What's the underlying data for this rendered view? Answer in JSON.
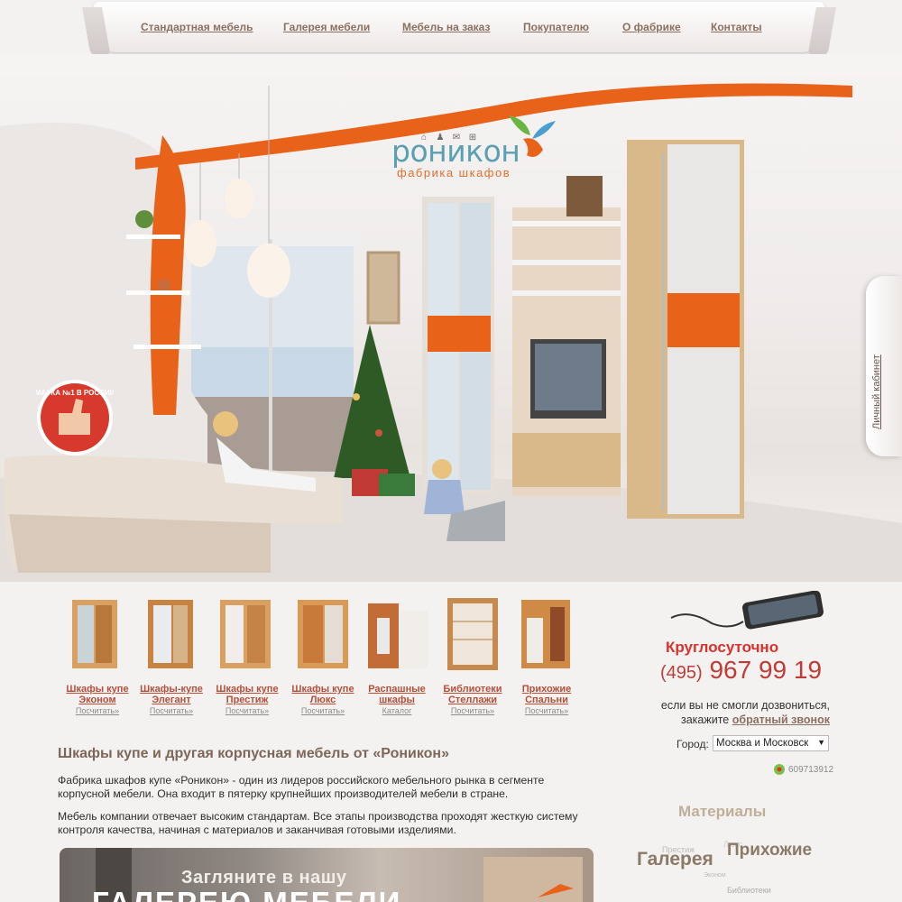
{
  "nav": {
    "items": [
      {
        "label": "Стандартная мебель"
      },
      {
        "label": "Галерея мебели"
      },
      {
        "label": "Мебель на заказ"
      },
      {
        "label": "Покупателю"
      },
      {
        "label": "О фабрике"
      },
      {
        "label": "Контакты"
      }
    ]
  },
  "logo": {
    "icons": [
      "home-icon",
      "users-icon",
      "mail-icon",
      "sitemap-icon"
    ],
    "name": "роникон",
    "tagline": "фабрика шкафов"
  },
  "side_tab": {
    "label": "Личный кабинет"
  },
  "badge": {
    "text": "МАРКА №1 В РОССИИ"
  },
  "products": [
    {
      "name1": "Шкафы купе",
      "name2": "Эконом",
      "sub": "Посчитать»"
    },
    {
      "name1": "Шкафы-купе",
      "name2": "Элегант",
      "sub": "Посчитать»"
    },
    {
      "name1": "Шкафы купе",
      "name2": "Престиж",
      "sub": "Посчитать»"
    },
    {
      "name1": "Шкафы купе",
      "name2": "Люкс",
      "sub": "Посчитать»"
    },
    {
      "name1": "Распашные",
      "name2": "шкафы",
      "sub": "Каталог"
    },
    {
      "name1": "Библиотеки",
      "name2": "Стеллажи",
      "sub": "Посчитать»"
    },
    {
      "name1": "Прихожие",
      "name2": "Спальни",
      "sub": "Посчитать»"
    }
  ],
  "contact": {
    "around_clock": "Круглосуточно",
    "phone_code": "(495)",
    "phone_number": "967 99 19",
    "note_line1": "если вы не смогли дозвониться,",
    "note_line2": "закажите",
    "callback_link": "обратный звонок",
    "city_label": "Город:",
    "city_value": "Москва и Московск",
    "icq": "609713912"
  },
  "tags": {
    "materials": "Материалы",
    "prestige": "Престиж",
    "lux": "Люкс",
    "hallways": "Прихожие",
    "gallery": "Галерея",
    "econom": "Эконом",
    "libraries": "Библиотеки"
  },
  "content": {
    "title": "Шкафы купе и другая корпусная мебель от «Роникон»",
    "para1": "Фабрика шкафов купе «Роникон» - один из лидеров российского мебельного рынка в сегменте корпусной мебели. Она входит в пятерку крупнейших производителей мебели в стране.",
    "para2": "Мебель компании отвечает высоким стандартам. Все этапы производства проходят жесткую систему контроля качества, начиная с материалов и заканчивая готовыми изделиями."
  },
  "banner": {
    "line1": "Загляните в нашу",
    "line2": "ГАЛЕРЕЮ МЕБЕЛИ"
  },
  "colors": {
    "accent": "#e8621a",
    "link": "#b74e38",
    "nav": "#8b6f60",
    "logo_blue": "#5aa0b0"
  }
}
